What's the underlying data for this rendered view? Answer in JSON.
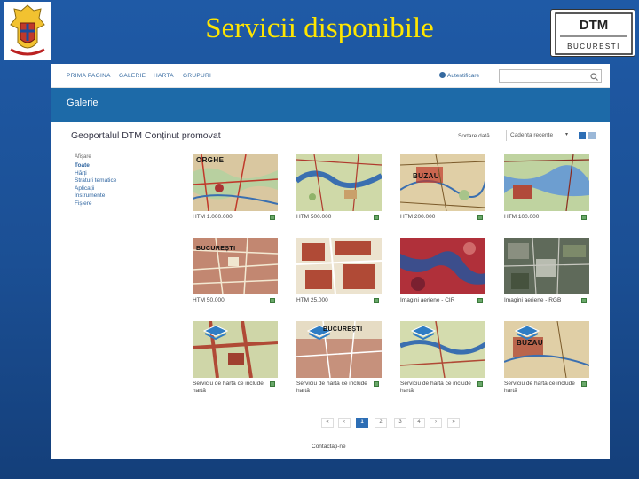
{
  "slide": {
    "title": "Servicii disponibile",
    "left_emblem": "coat-of-arms",
    "right_logo": {
      "top": "DTM",
      "bottom": "BUCURESTI"
    }
  },
  "nav": {
    "items": [
      "PRIMA PAGINA",
      "GALERIE",
      "HARTA",
      "GRUPURI"
    ],
    "auth": "Autentificare",
    "search_placeholder": ""
  },
  "banner": {
    "title": "Galerie"
  },
  "gallery": {
    "title": "Geoportalul DTM Conținut promovat",
    "sort_label": "Sortare dată",
    "sort_value": "Cadenta recente"
  },
  "filter": {
    "heading": "Afișare",
    "items": [
      "Toate",
      "Hărți",
      "Straturi tematice",
      "Aplicații",
      "Instrumente",
      "Fișiere"
    ],
    "active": "Toate"
  },
  "items": [
    {
      "label": "HTM 1.000.000",
      "map_text": "ORGHE"
    },
    {
      "label": "HTM 500.000",
      "map_text": ""
    },
    {
      "label": "HTM 200.000",
      "map_text": "BUZAU"
    },
    {
      "label": "HTM 100.000",
      "map_text": ""
    },
    {
      "label": "HTM 50.000",
      "map_text": "BUCUREȘTI"
    },
    {
      "label": "HTM 25.000",
      "map_text": ""
    },
    {
      "label": "Imagini aeriene - CIR",
      "map_text": ""
    },
    {
      "label": "Imagini aeriene - RGB",
      "map_text": ""
    },
    {
      "label": "Serviciu de hartă ce include hartă",
      "map_text": ""
    },
    {
      "label": "Serviciu de hartă ce include hartă",
      "map_text": "BUCUREȘTI"
    },
    {
      "label": "Serviciu de hartă ce include hartă",
      "map_text": ""
    },
    {
      "label": "Serviciu de hartă ce include hartă",
      "map_text": "BUZAU"
    }
  ],
  "pagination": [
    "«",
    "‹",
    "1",
    "2",
    "3",
    "4",
    "›",
    "»"
  ],
  "pagination_active": "1",
  "footer": {
    "contact": "Contactați-ne"
  },
  "colors": {
    "slide_bg": "#1b4f94",
    "title_yellow": "#ffe600",
    "banner_blue": "#1d6aa8",
    "link_blue": "#2f65a0"
  }
}
